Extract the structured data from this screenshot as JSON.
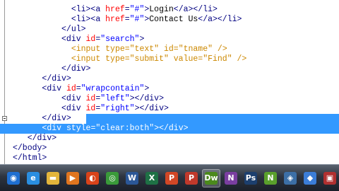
{
  "editor": {
    "lines": [
      [
        {
          "c": "x",
          "s": "            "
        },
        {
          "c": "t",
          "s": "<li><a "
        },
        {
          "c": "a",
          "s": "href"
        },
        {
          "c": "t",
          "s": "="
        },
        {
          "c": "v",
          "s": "\"#\""
        },
        {
          "c": "t",
          "s": ">"
        },
        {
          "c": "x",
          "s": "Login"
        },
        {
          "c": "t",
          "s": "</a></li>"
        }
      ],
      [
        {
          "c": "x",
          "s": "            "
        },
        {
          "c": "t",
          "s": "<li><a "
        },
        {
          "c": "a",
          "s": "href"
        },
        {
          "c": "t",
          "s": "="
        },
        {
          "c": "v",
          "s": "\"#\""
        },
        {
          "c": "t",
          "s": ">"
        },
        {
          "c": "x",
          "s": "Contact Us"
        },
        {
          "c": "t",
          "s": "</a></li>"
        }
      ],
      [
        {
          "c": "x",
          "s": "          "
        },
        {
          "c": "t",
          "s": "</ul>"
        }
      ],
      [
        {
          "c": "x",
          "s": "          "
        },
        {
          "c": "t",
          "s": "<div "
        },
        {
          "c": "a",
          "s": "id"
        },
        {
          "c": "t",
          "s": "="
        },
        {
          "c": "v",
          "s": "\"search\""
        },
        {
          "c": "t",
          "s": ">"
        }
      ],
      [
        {
          "c": "x",
          "s": "            "
        },
        {
          "c": "t",
          "s": "<input "
        },
        {
          "c": "a",
          "s": "type"
        },
        {
          "c": "t",
          "s": "="
        },
        {
          "c": "v",
          "s": "\"text\""
        },
        {
          "c": "t",
          "s": " "
        },
        {
          "c": "a",
          "s": "id"
        },
        {
          "c": "t",
          "s": "="
        },
        {
          "c": "v",
          "s": "\"tname\""
        },
        {
          "c": "t",
          "s": " />"
        }
      ],
      [
        {
          "c": "x",
          "s": "            "
        },
        {
          "c": "t",
          "s": "<input "
        },
        {
          "c": "a",
          "s": "type"
        },
        {
          "c": "t",
          "s": "="
        },
        {
          "c": "v",
          "s": "\"submit\""
        },
        {
          "c": "t",
          "s": " "
        },
        {
          "c": "a",
          "s": "value"
        },
        {
          "c": "t",
          "s": "="
        },
        {
          "c": "v",
          "s": "\"Find\""
        },
        {
          "c": "t",
          "s": " />"
        }
      ],
      [
        {
          "c": "x",
          "s": "          "
        },
        {
          "c": "t",
          "s": "</div>"
        }
      ],
      [
        {
          "c": "x",
          "s": "      "
        },
        {
          "c": "t",
          "s": "</div>"
        }
      ],
      [
        {
          "c": "x",
          "s": "      "
        },
        {
          "c": "t",
          "s": "<div "
        },
        {
          "c": "a",
          "s": "id"
        },
        {
          "c": "t",
          "s": "="
        },
        {
          "c": "v",
          "s": "\"wrapcontain\""
        },
        {
          "c": "t",
          "s": ">"
        }
      ],
      [
        {
          "c": "x",
          "s": "          "
        },
        {
          "c": "t",
          "s": "<div "
        },
        {
          "c": "a",
          "s": "id"
        },
        {
          "c": "t",
          "s": "="
        },
        {
          "c": "v",
          "s": "\"left\""
        },
        {
          "c": "t",
          "s": "></div>"
        }
      ],
      [
        {
          "c": "x",
          "s": "          "
        },
        {
          "c": "t",
          "s": "<div "
        },
        {
          "c": "a",
          "s": "id"
        },
        {
          "c": "t",
          "s": "="
        },
        {
          "c": "v",
          "s": "\"right\""
        },
        {
          "c": "t",
          "s": "></div>"
        }
      ],
      [
        {
          "c": "x",
          "s": "      "
        },
        {
          "c": "t",
          "s": "</div>"
        }
      ],
      [
        {
          "c": "x",
          "s": "      "
        },
        {
          "c": "t",
          "s": "<div "
        },
        {
          "c": "a",
          "s": "style"
        },
        {
          "c": "t",
          "s": "="
        },
        {
          "c": "v",
          "s": "\"clear:both\""
        },
        {
          "c": "t",
          "s": "></div>"
        }
      ],
      [
        {
          "c": "x",
          "s": "   "
        },
        {
          "c": "t",
          "s": "</div>"
        }
      ],
      [
        {
          "c": "t",
          "s": "</body>"
        }
      ],
      [
        {
          "c": "t",
          "s": "</html>"
        }
      ]
    ],
    "dim_lines": [
      4,
      5
    ],
    "selected_lines": [
      12
    ],
    "partial_selected_lines": [
      11
    ]
  },
  "taskbar": {
    "buttons": [
      {
        "name": "start-orb-icon",
        "glyph": "◉",
        "bg": "#1f6fd1"
      },
      {
        "name": "internet-explorer-icon",
        "glyph": "e",
        "bg": "#2a8ee0"
      },
      {
        "name": "windows-explorer-icon",
        "glyph": "▬",
        "bg": "#e3b53b"
      },
      {
        "name": "media-player-icon",
        "glyph": "▶",
        "bg": "#e0751f"
      },
      {
        "name": "firefox-icon",
        "glyph": "◐",
        "bg": "#d9431a"
      },
      {
        "name": "chrome-icon",
        "glyph": "◎",
        "bg": "#3a9a3a"
      },
      {
        "name": "word-icon",
        "glyph": "W",
        "bg": "#2b5797"
      },
      {
        "name": "excel-icon",
        "glyph": "X",
        "bg": "#1e7145"
      },
      {
        "name": "powerpoint-icon",
        "glyph": "P",
        "bg": "#d24726"
      },
      {
        "name": "publisher-icon",
        "glyph": "P",
        "bg": "#c0392b"
      },
      {
        "name": "dreamweaver-icon",
        "glyph": "Dw",
        "bg": "#4b8a1c"
      },
      {
        "name": "onenote-icon",
        "glyph": "N",
        "bg": "#7a3ea0"
      },
      {
        "name": "photoshop-icon",
        "glyph": "Ps",
        "bg": "#1c3f6e"
      },
      {
        "name": "notepad-plus-icon",
        "glyph": "N",
        "bg": "#5aa02c"
      },
      {
        "name": "network-icon",
        "glyph": "◈",
        "bg": "#3c6fa6"
      },
      {
        "name": "app-icon",
        "glyph": "◆",
        "bg": "#3b7dd8"
      },
      {
        "name": "media-icon",
        "glyph": "▣",
        "bg": "#b03030"
      }
    ],
    "active_index": 10
  }
}
